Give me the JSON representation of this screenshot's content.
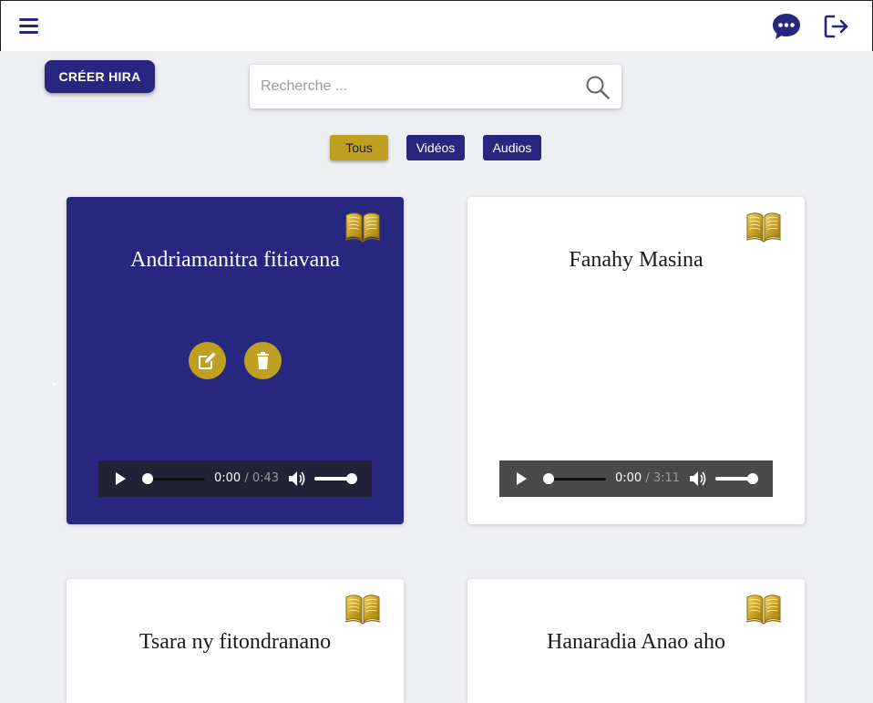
{
  "header": {
    "menu_icon": "hamburger-menu-icon",
    "chat_icon": "chat-bubble-icon",
    "logout_icon": "logout-icon",
    "accent_color": "#27277f"
  },
  "toolbar": {
    "create_label": "CRÉER HIRA"
  },
  "search": {
    "placeholder": "Recherche ...",
    "value": "",
    "icon": "search-icon"
  },
  "filters": [
    {
      "label": "Tous",
      "active": true
    },
    {
      "label": "Vidéos",
      "active": false
    },
    {
      "label": "Audios",
      "active": false
    }
  ],
  "cards": [
    {
      "title": "Andriamanitra fitiavana",
      "selected": true,
      "player": {
        "current": "0:00",
        "duration": "0:43"
      },
      "icon": "book-icon",
      "actions": [
        "edit-icon",
        "trash-icon"
      ]
    },
    {
      "title": "Fanahy Masina",
      "selected": false,
      "player": {
        "current": "0:00",
        "duration": "3:11"
      },
      "icon": "book-icon"
    },
    {
      "title": "Tsara ny fitondranano",
      "selected": false,
      "icon": "book-icon"
    },
    {
      "title": "Hanaradia Anao aho",
      "selected": false,
      "icon": "book-icon"
    }
  ],
  "colors": {
    "primary": "#27277f",
    "gold": "#c0a020",
    "background": "#eeeff3"
  }
}
